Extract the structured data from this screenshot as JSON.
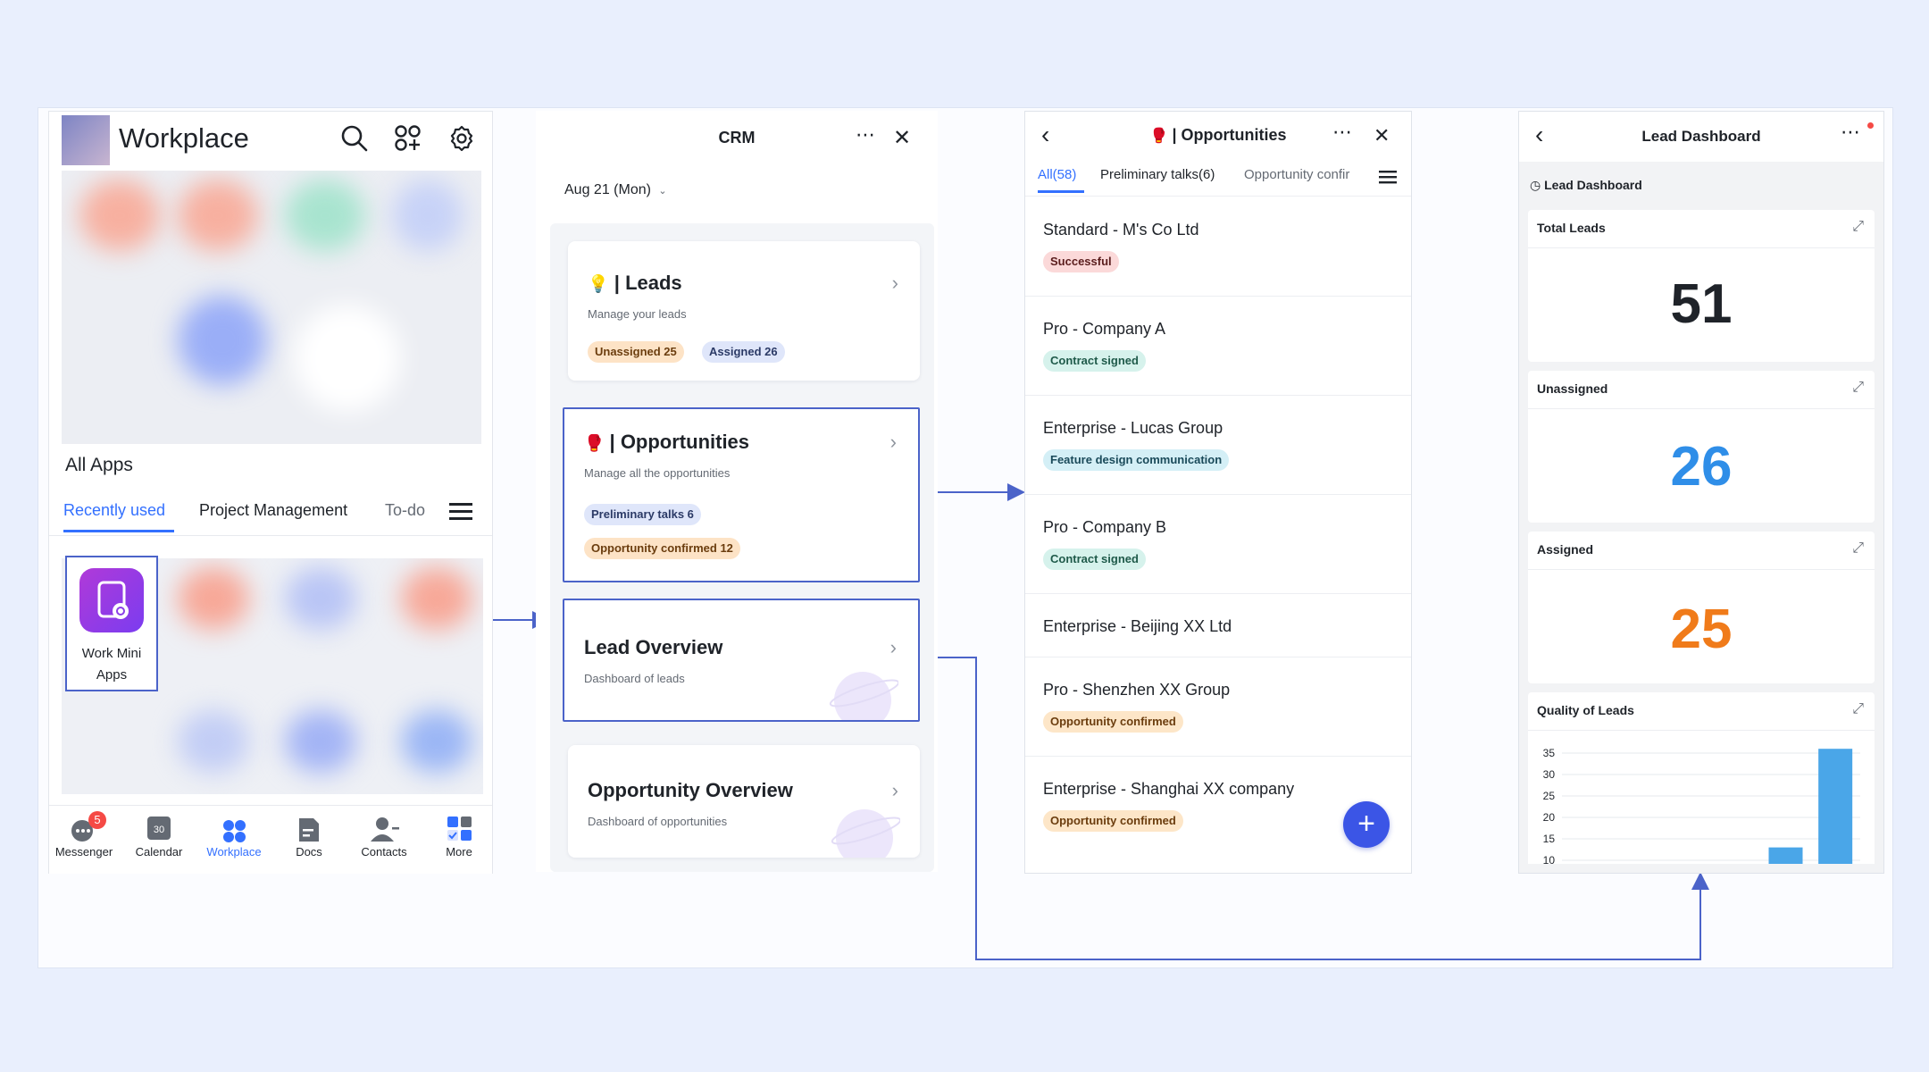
{
  "workplace": {
    "title": "Workplace",
    "section_title": "All Apps",
    "tabs": [
      {
        "label": "Recently used",
        "active": true
      },
      {
        "label": "Project Management"
      },
      {
        "label": "To-do"
      }
    ],
    "app": {
      "label_line1": "Work Mini",
      "label_line2": "Apps"
    },
    "bottom_nav": [
      {
        "label": "Messenger",
        "badge": "5",
        "icon": "messenger-icon"
      },
      {
        "label": "Calendar",
        "icon": "calendar-icon",
        "icon_text": "30"
      },
      {
        "label": "Workplace",
        "icon": "workplace-icon",
        "active": true
      },
      {
        "label": "Docs",
        "icon": "docs-icon"
      },
      {
        "label": "Contacts",
        "icon": "contacts-icon"
      },
      {
        "label": "More",
        "icon": "more-apps-icon"
      }
    ]
  },
  "crm": {
    "title": "CRM",
    "date": "Aug 21 (Mon)",
    "leads": {
      "title": "| Leads",
      "subtitle": "Manage your leads",
      "pill1": "Unassigned 25",
      "pill2": "Assigned 26"
    },
    "opportunities": {
      "title": "| Opportunities",
      "subtitle": "Manage all the opportunities",
      "pill1": "Preliminary talks 6",
      "pill2": "Opportunity confirmed 12"
    },
    "lead_overview": {
      "title": "Lead Overview",
      "subtitle": "Dashboard of leads"
    },
    "opportunity_overview": {
      "title": "Opportunity Overview",
      "subtitle": "Dashboard of opportunities"
    }
  },
  "opportunities": {
    "title": "| Opportunities",
    "tabs": [
      "All(58)",
      "Preliminary talks(6)",
      "Opportunity confir"
    ],
    "items": [
      {
        "title": "Standard - M's Co Ltd",
        "tag": "Successful",
        "tag_style": "red"
      },
      {
        "title": "Pro - Company A",
        "tag": "Contract signed",
        "tag_style": "green"
      },
      {
        "title": "Enterprise - Lucas Group",
        "tag": "Feature design communication",
        "tag_style": "teal"
      },
      {
        "title": "Pro - Company B",
        "tag": "Contract signed",
        "tag_style": "green"
      },
      {
        "title": "Enterprise - Beijing XX Ltd",
        "tag": "",
        "tag_style": ""
      },
      {
        "title": "Pro - Shenzhen XX Group",
        "tag": "Opportunity confirmed",
        "tag_style": "amber"
      },
      {
        "title": "Enterprise - Shanghai XX company",
        "tag": "Opportunity confirmed",
        "tag_style": "amber"
      }
    ],
    "fab": "+"
  },
  "dashboard": {
    "title": "Lead Dashboard",
    "breadcrumb": "Lead Dashboard",
    "total": {
      "label": "Total Leads",
      "value": "51"
    },
    "unassigned": {
      "label": "Unassigned",
      "value": "26"
    },
    "assigned": {
      "label": "Assigned",
      "value": "25"
    },
    "quality": {
      "label": "Quality of Leads"
    }
  },
  "colors": {
    "accent": "#3370ff",
    "blue_number": "#2f8ee8",
    "orange_number": "#f07b1a",
    "highlight_border": "#4b63c9"
  },
  "chart_data": {
    "type": "bar",
    "title": "Quality of Leads",
    "xlabel": "",
    "ylabel": "",
    "y_ticks": [
      10,
      15,
      20,
      25,
      30,
      35
    ],
    "ylim": [
      10,
      35
    ],
    "grid": true,
    "slots": 6,
    "series": [
      {
        "values": [
          null,
          null,
          null,
          null,
          13,
          36
        ]
      }
    ]
  }
}
